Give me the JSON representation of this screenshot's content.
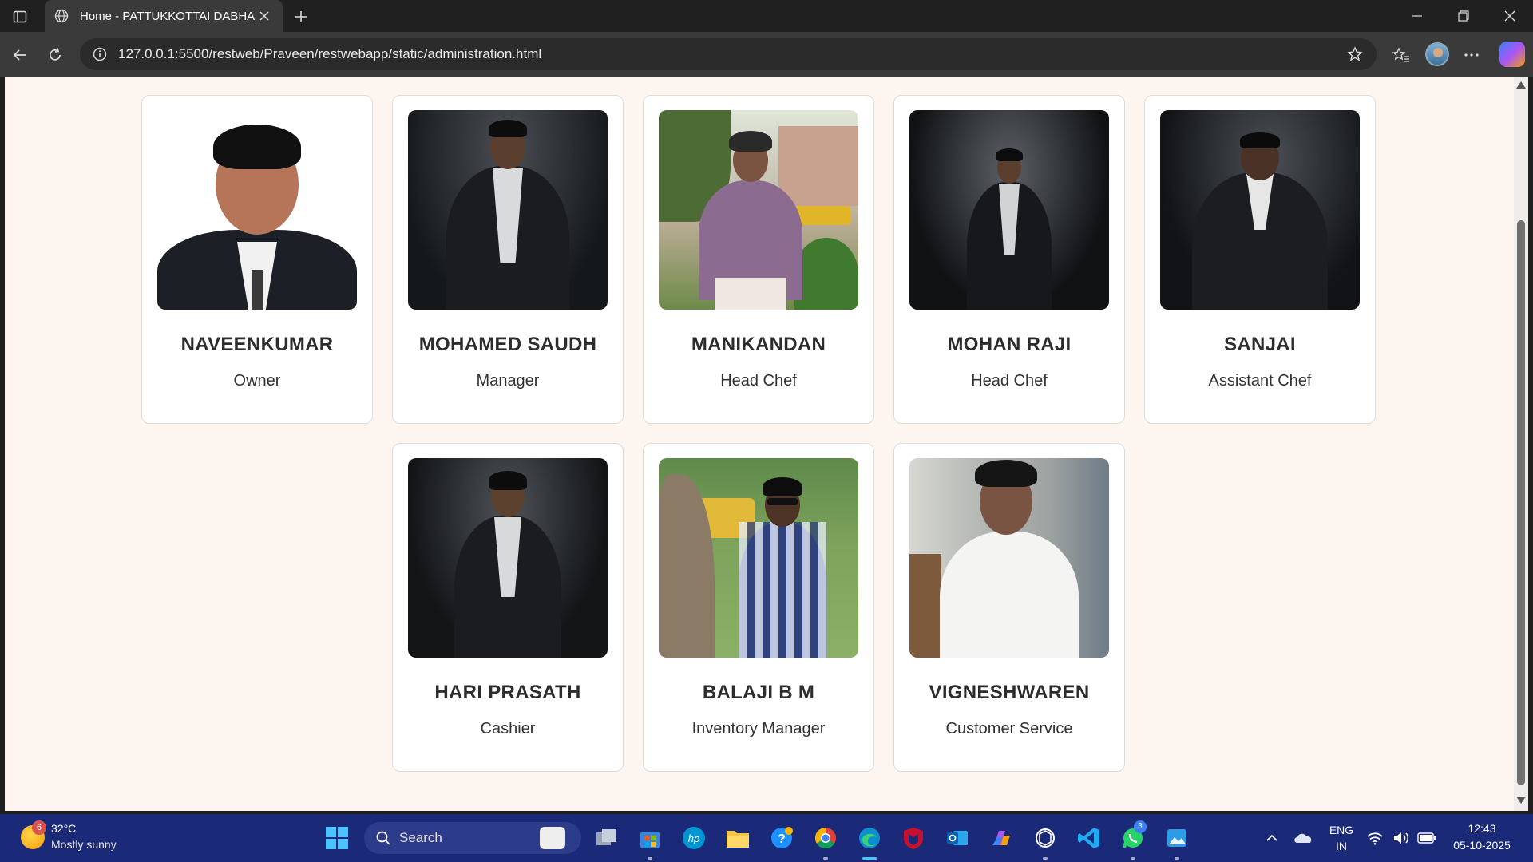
{
  "browser": {
    "tab_title": "Home - PATTUKKOTTAI DABHA",
    "url": "127.0.0.1:5500/restweb/Praveen/restwebapp/static/administration.html"
  },
  "staff": [
    {
      "name": "NAVEENKUMAR",
      "role": "Owner"
    },
    {
      "name": "MOHAMED SAUDH",
      "role": "Manager"
    },
    {
      "name": "MANIKANDAN",
      "role": "Head Chef"
    },
    {
      "name": "MOHAN RAJI",
      "role": "Head Chef"
    },
    {
      "name": "SANJAI",
      "role": "Assistant Chef"
    },
    {
      "name": "HARI PRASATH",
      "role": "Cashier"
    },
    {
      "name": "BALAJI B M",
      "role": "Inventory Manager"
    },
    {
      "name": "VIGNESHWAREN",
      "role": "Customer Service"
    }
  ],
  "taskbar": {
    "weather_badge": "6",
    "temperature": "32°C",
    "weather": "Mostly sunny",
    "search_label": "Search",
    "whatsapp_badge": "3",
    "language": "ENG",
    "region": "IN",
    "time": "12:43",
    "date": "05-10-2025"
  },
  "colors": {
    "page_background": "#fdf5f0",
    "card_background": "#ffffff",
    "taskbar": "#1b2a78"
  }
}
